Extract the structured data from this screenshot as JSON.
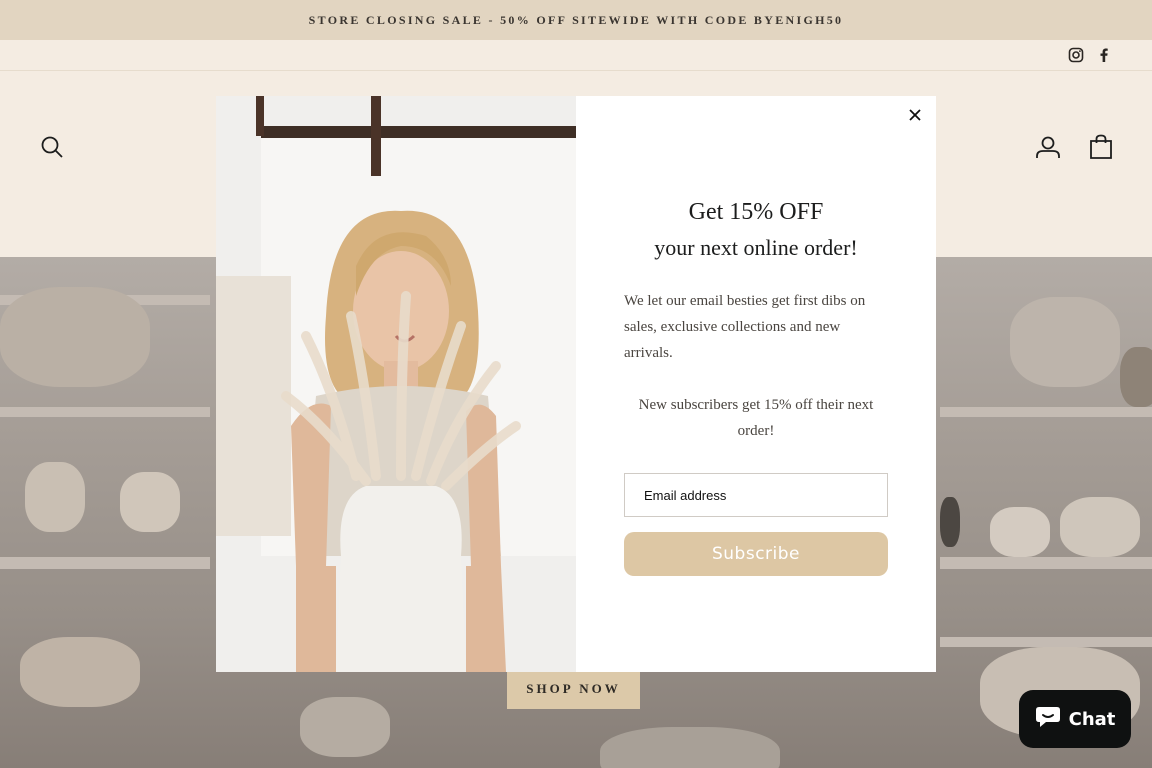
{
  "announcement": {
    "text": "STORE CLOSING SALE - 50% OFF SITEWIDE WITH CODE BYENIGH50"
  },
  "social": {
    "instagram": "Instagram",
    "facebook": "Facebook"
  },
  "header": {
    "search_icon": "search-icon",
    "account_icon": "user-icon",
    "cart_icon": "cart-icon"
  },
  "hero": {
    "cta_label": "SHOP NOW"
  },
  "popup": {
    "headline_line1": "Get 15% OFF",
    "headline_line2": "your next online order!",
    "description": "We let our email besties get first dibs on sales, exclusive collections and new arrivals.",
    "subscriber_note": "New subscribers get 15% off their next order!",
    "email_placeholder": "Email address",
    "email_value": "",
    "subscribe_label": "Subscribe",
    "close_icon": "close-icon"
  },
  "chat": {
    "label": "Chat",
    "icon": "chat-bubble-icon"
  },
  "colors": {
    "announcement_bg": "#e2d5c1",
    "header_bg": "#f4ece2",
    "accent": "#ddc7a4",
    "chat_bg": "#0f1111"
  }
}
